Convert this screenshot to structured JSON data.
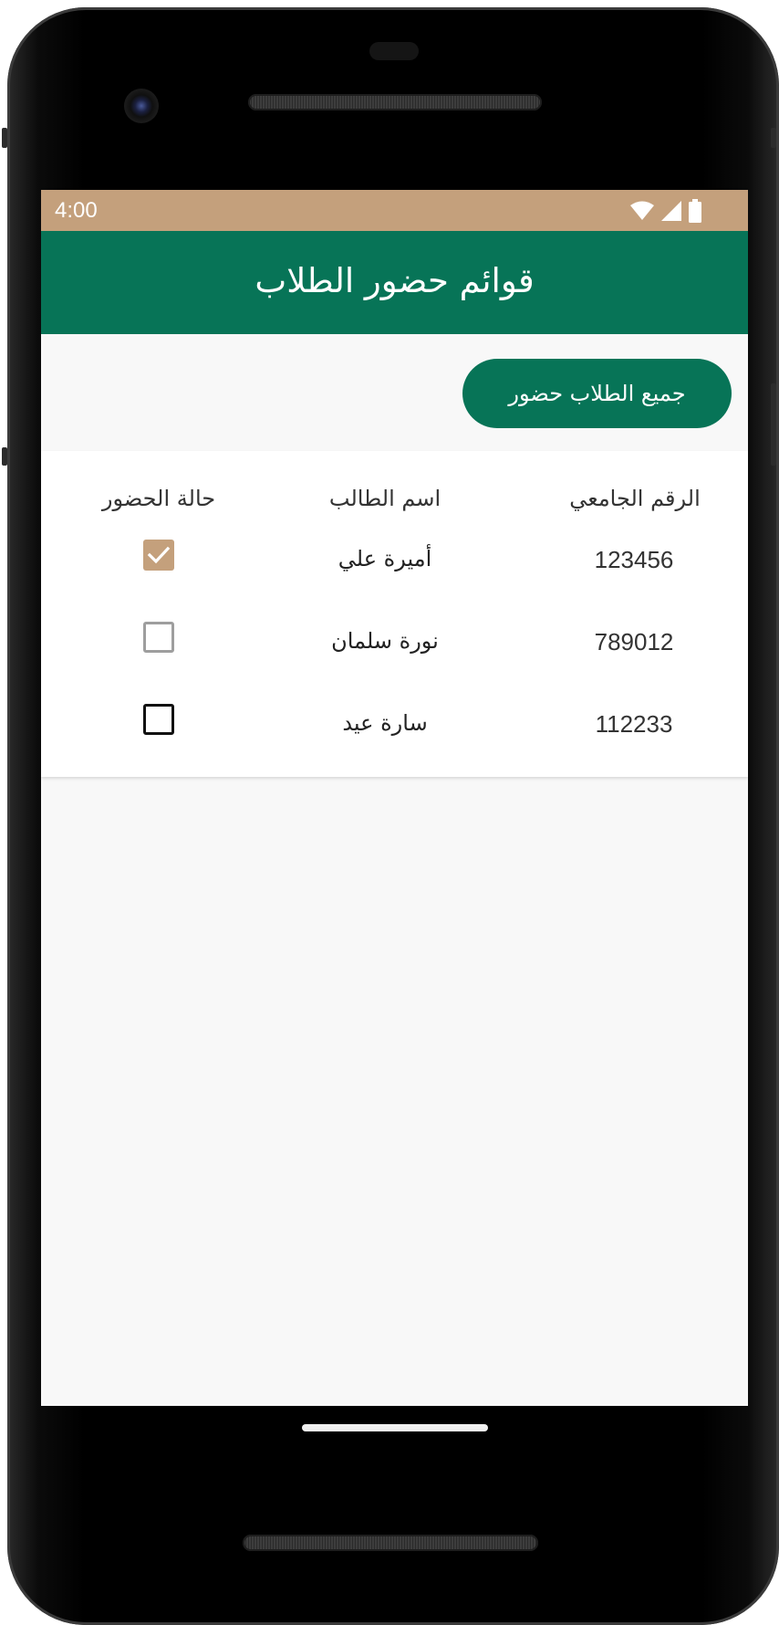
{
  "status_bar": {
    "time": "4:00",
    "color": "#c4a07c",
    "icons": [
      "wifi-icon",
      "cellular-signal-icon",
      "battery-icon"
    ]
  },
  "app_bar": {
    "title": "قوائم حضور الطلاب",
    "color": "#077457"
  },
  "actions": {
    "mark_all_present_label": "جميع الطلاب حضور"
  },
  "table": {
    "headers": {
      "student_id": "الرقم الجامعي",
      "student_name": "اسم الطالب",
      "attendance_status": "حالة الحضور"
    },
    "rows": [
      {
        "student_id": "123456",
        "student_name": "أميرة علي",
        "present": true
      },
      {
        "student_id": "789012",
        "student_name": "نورة سلمان",
        "present": false
      },
      {
        "student_id": "112233",
        "student_name": "سارة عيد",
        "present": false
      }
    ]
  },
  "colors": {
    "accent": "#c4a07c",
    "primary": "#077457"
  }
}
